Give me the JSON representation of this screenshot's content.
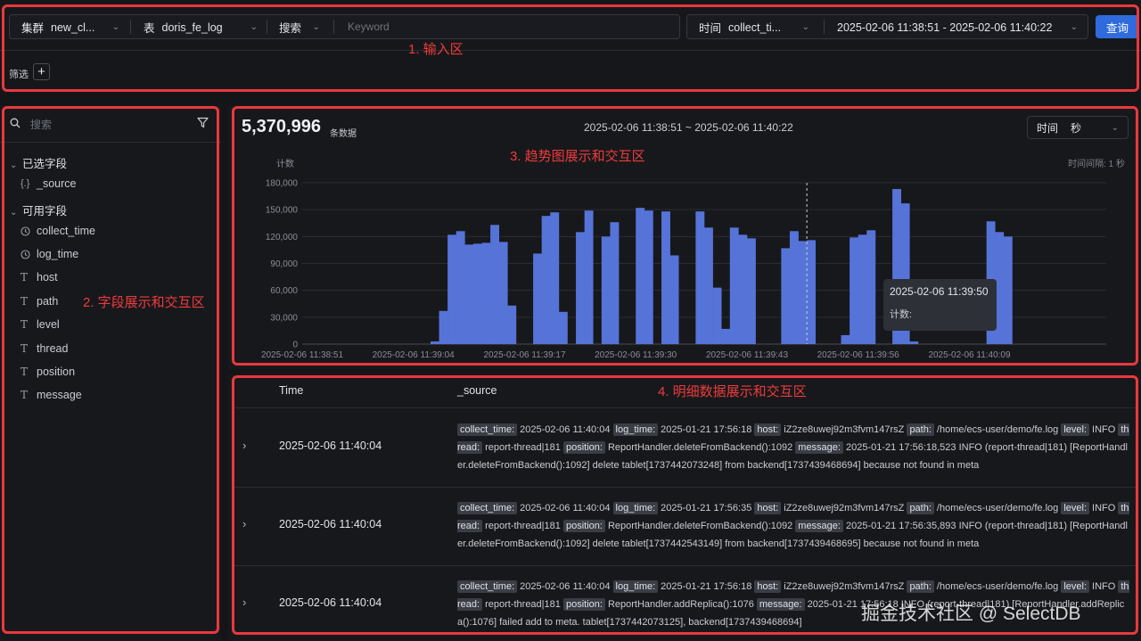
{
  "toolbar": {
    "cluster_label": "集群",
    "cluster_value": "new_cl...",
    "table_label": "表",
    "table_value": "doris_fe_log",
    "search_mode": "搜索",
    "keyword_placeholder": "Keyword",
    "time_label": "时间",
    "time_field": "collect_ti...",
    "time_range": "2025-02-06 11:38:51 - 2025-02-06 11:40:22",
    "query_button": "查询",
    "filter_label": "筛选",
    "filter_add": "+"
  },
  "annotations": {
    "input_area": "1. 输入区",
    "field_area": "2. 字段展示和交互区",
    "chart_area": "3. 趋势图展示和交互区",
    "detail_area": "4. 明细数据展示和交互区"
  },
  "sidebar": {
    "search_placeholder": "搜索",
    "selected_group": "已选字段",
    "selected_fields": [
      {
        "name": "_source",
        "icon": "braces-icon"
      }
    ],
    "available_group": "可用字段",
    "available_fields": [
      {
        "name": "collect_time",
        "icon": "clock-icon"
      },
      {
        "name": "log_time",
        "icon": "clock-icon"
      },
      {
        "name": "host",
        "icon": "text-icon"
      },
      {
        "name": "path",
        "icon": "text-icon"
      },
      {
        "name": "level",
        "icon": "text-icon"
      },
      {
        "name": "thread",
        "icon": "text-icon"
      },
      {
        "name": "position",
        "icon": "text-icon"
      },
      {
        "name": "message",
        "icon": "text-icon"
      }
    ]
  },
  "summary": {
    "total": "5,370,996",
    "total_unit": "条数据",
    "range": "2025-02-06 11:38:51 ~ 2025-02-06 11:40:22",
    "interval_label": "时间",
    "interval_value": "秒",
    "interval_note": "时间间隔: 1 秒"
  },
  "chart_data": {
    "type": "bar",
    "ylabel": "计数",
    "ylim": [
      0,
      180000
    ],
    "yticks": [
      "0",
      "30,000",
      "60,000",
      "90,000",
      "120,000",
      "150,000",
      "180,000"
    ],
    "xticks": [
      "2025-02-06 11:38:51",
      "2025-02-06 11:39:04",
      "2025-02-06 11:39:17",
      "2025-02-06 11:39:30",
      "2025-02-06 11:39:43",
      "2025-02-06 11:39:56",
      "2025-02-06 11:40:09"
    ],
    "bar_color": "#5673d8",
    "values": [
      0,
      0,
      0,
      0,
      0,
      0,
      0,
      0,
      0,
      0,
      0,
      0,
      0,
      0,
      0,
      3000,
      37000,
      122000,
      126000,
      111000,
      112000,
      113000,
      133000,
      114000,
      43000,
      0,
      0,
      101000,
      143000,
      147000,
      36000,
      0,
      125000,
      149000,
      0,
      120000,
      136000,
      0,
      0,
      152000,
      149000,
      0,
      148000,
      99000,
      0,
      0,
      148000,
      130000,
      63000,
      17000,
      130000,
      122000,
      118000,
      0,
      0,
      0,
      107000,
      126000,
      115000,
      116000,
      0,
      0,
      0,
      10000,
      119000,
      122000,
      127000,
      0,
      0,
      173000,
      157000,
      3000,
      0,
      0,
      0,
      0,
      0,
      0,
      0,
      0,
      137000,
      125000,
      120000,
      0,
      0,
      0,
      0,
      0,
      0,
      0,
      0,
      0,
      0,
      0
    ],
    "hover": {
      "time": "2025-02-06 11:39:50",
      "label": "计数:"
    }
  },
  "table": {
    "headers": [
      "Time",
      "_source"
    ],
    "rows": [
      {
        "time": "2025-02-06 11:40:04",
        "fields": [
          [
            "collect_time:",
            "2025-02-06 11:40:04"
          ],
          [
            "log_time:",
            "2025-01-21 17:56:18"
          ],
          [
            "host:",
            "iZ2ze8uwej92m3fvm147rsZ"
          ],
          [
            "path:",
            "/home/ecs-user/demo/fe.log"
          ],
          [
            "level:",
            "INFO"
          ],
          [
            "thread:",
            "report-thread|181"
          ],
          [
            "position:",
            "ReportHandler.deleteFromBackend():1092"
          ],
          [
            "message:",
            "2025-01-21 17:56:18,523 INFO (report-thread|181) [ReportHandler.deleteFromBackend():1092] delete tablet[1737442073248] from backend[1737439468694] because not found in meta"
          ]
        ]
      },
      {
        "time": "2025-02-06 11:40:04",
        "fields": [
          [
            "collect_time:",
            "2025-02-06 11:40:04"
          ],
          [
            "log_time:",
            "2025-01-21 17:56:35"
          ],
          [
            "host:",
            "iZ2ze8uwej92m3fvm147rsZ"
          ],
          [
            "path:",
            "/home/ecs-user/demo/fe.log"
          ],
          [
            "level:",
            "INFO"
          ],
          [
            "thread:",
            "report-thread|181"
          ],
          [
            "position:",
            "ReportHandler.deleteFromBackend():1092"
          ],
          [
            "message:",
            "2025-01-21 17:56:35,893 INFO (report-thread|181) [ReportHandler.deleteFromBackend():1092] delete tablet[1737442543149] from backend[1737439468695] because not found in meta"
          ]
        ]
      },
      {
        "time": "2025-02-06 11:40:04",
        "fields": [
          [
            "collect_time:",
            "2025-02-06 11:40:04"
          ],
          [
            "log_time:",
            "2025-01-21 17:56:18"
          ],
          [
            "host:",
            "iZ2ze8uwej92m3fvm147rsZ"
          ],
          [
            "path:",
            "/home/ecs-user/demo/fe.log"
          ],
          [
            "level:",
            "INFO"
          ],
          [
            "thread:",
            "report-thread|181"
          ],
          [
            "position:",
            "ReportHandler.addReplica():1076"
          ],
          [
            "message:",
            "2025-01-21 17:56:18 INFO (report-thread|181) [ReportHandler.addReplica():1076] failed add to meta. tablet[1737442073125], backend[1737439468694]"
          ]
        ]
      }
    ]
  },
  "watermark": "掘金技术社区 @ SelectDB"
}
